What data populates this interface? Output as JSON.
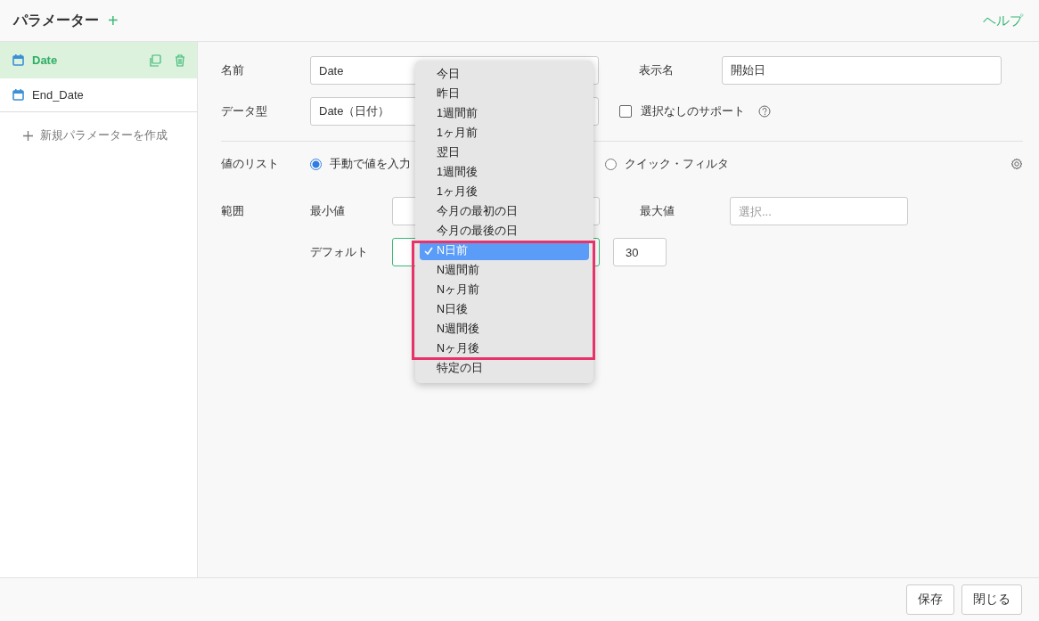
{
  "header": {
    "title": "パラメーター",
    "add_icon": "+",
    "help": "ヘルプ"
  },
  "sidebar": {
    "items": [
      {
        "label": "Date",
        "selected": true
      },
      {
        "label": "End_Date",
        "selected": false
      }
    ],
    "new_button": "新規パラメーターを作成"
  },
  "form": {
    "name_label": "名前",
    "name_value": "Date",
    "display_label": "表示名",
    "display_value": "開始日",
    "type_label": "データ型",
    "type_value": "Date（日付）",
    "null_support": {
      "label": "選択なしのサポート",
      "checked": false
    },
    "list_label": "値のリスト",
    "list_options": [
      {
        "label": "手動で値を入力",
        "selected": true
      },
      {
        "label": "クイック・フィルタ",
        "selected": false
      }
    ],
    "range_label": "範囲",
    "min_label": "最小値",
    "max_label": "最大値",
    "max_placeholder": "選択...",
    "default_label": "デフォルト",
    "default_number": "30"
  },
  "dropdown": {
    "options": [
      {
        "label": "今日",
        "selected": false
      },
      {
        "label": "昨日",
        "selected": false
      },
      {
        "label": "1週間前",
        "selected": false
      },
      {
        "label": "1ヶ月前",
        "selected": false
      },
      {
        "label": "翌日",
        "selected": false
      },
      {
        "label": "1週間後",
        "selected": false
      },
      {
        "label": "1ヶ月後",
        "selected": false
      },
      {
        "label": "今月の最初の日",
        "selected": false
      },
      {
        "label": "今月の最後の日",
        "selected": false
      },
      {
        "label": "N日前",
        "selected": true
      },
      {
        "label": "N週間前",
        "selected": false
      },
      {
        "label": "Nヶ月前",
        "selected": false
      },
      {
        "label": "N日後",
        "selected": false
      },
      {
        "label": "N週間後",
        "selected": false
      },
      {
        "label": "Nヶ月後",
        "selected": false
      },
      {
        "label": "特定の日",
        "selected": false
      }
    ]
  },
  "footer": {
    "buttons": [
      "保存",
      "閉じる"
    ]
  }
}
